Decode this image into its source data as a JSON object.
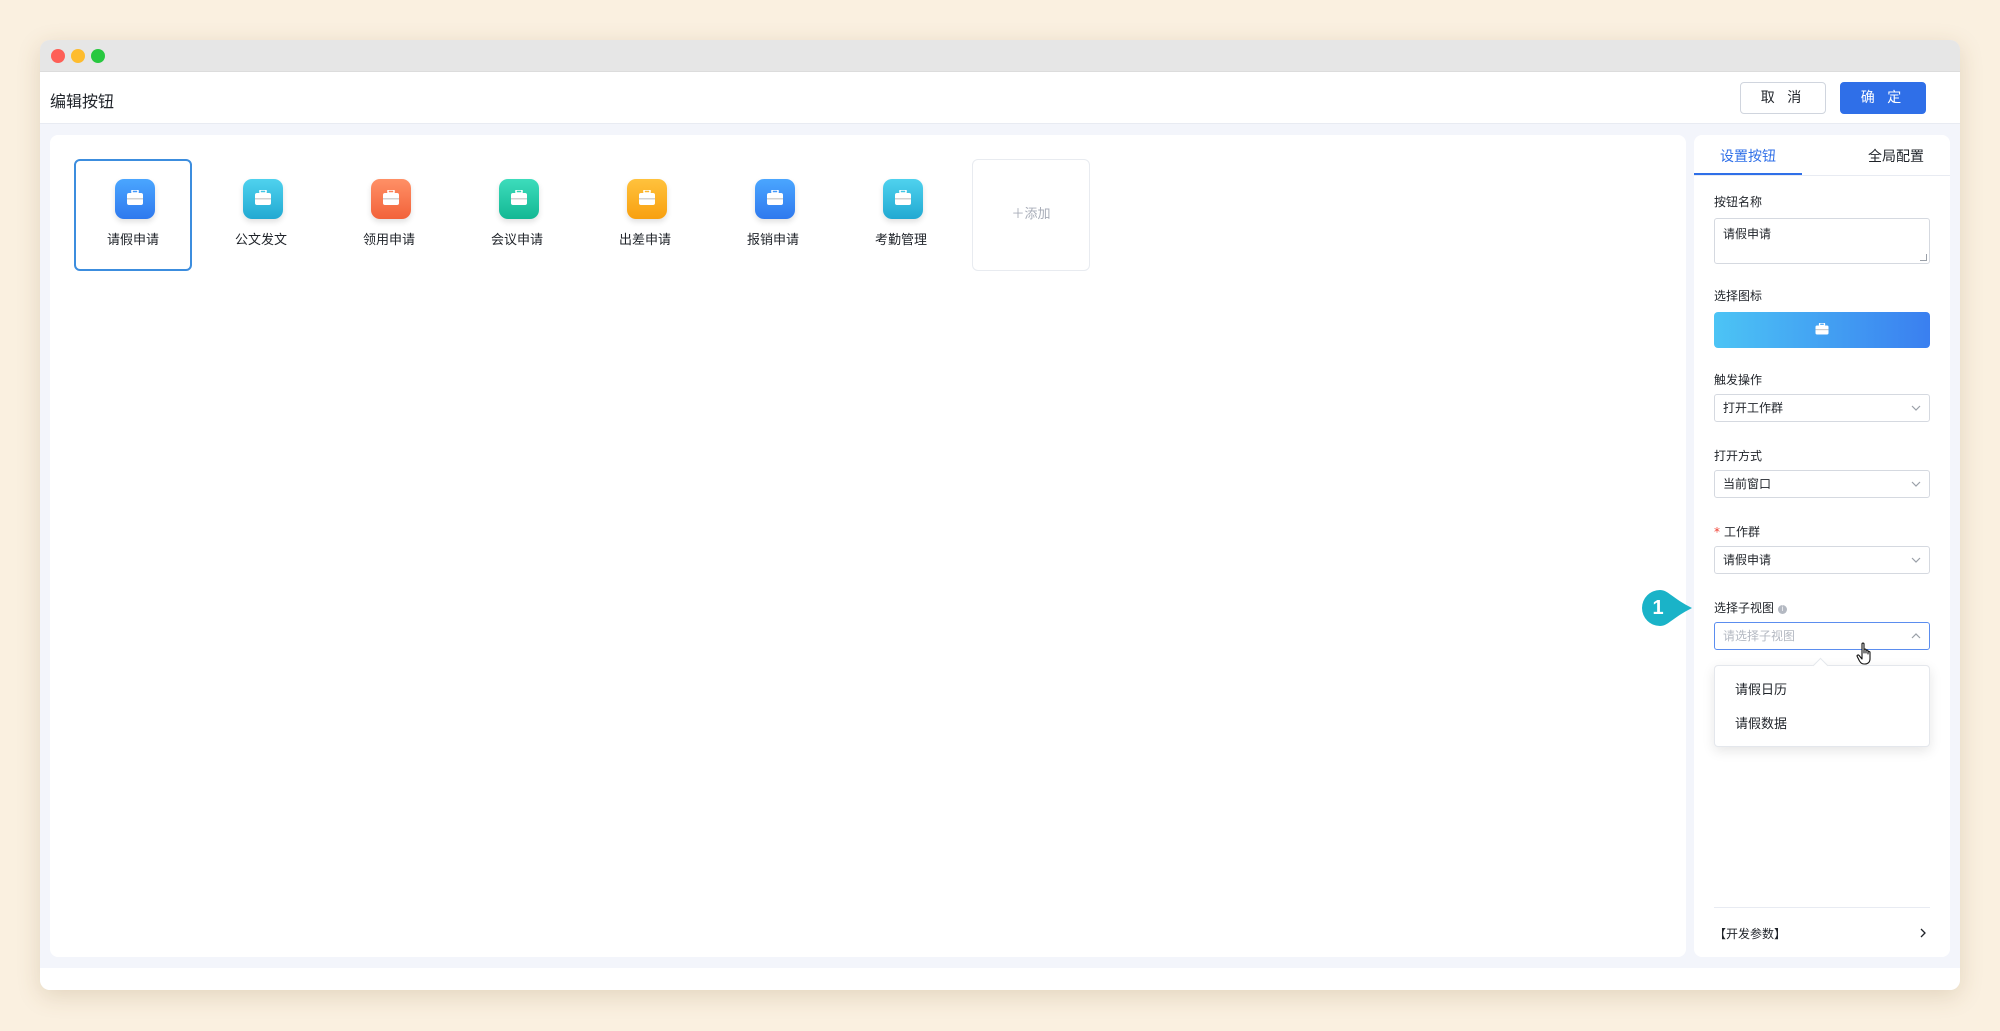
{
  "header": {
    "title": "编辑按钮",
    "cancel_label": "取 消",
    "confirm_label": "确 定"
  },
  "tiles": [
    {
      "label": "请假申请",
      "color": "#3a8ef6",
      "icon": "briefcase-icon"
    },
    {
      "label": "公文发文",
      "color": "#2ebcdc",
      "icon": "briefcase-icon"
    },
    {
      "label": "领用申请",
      "color": "#fa7a4a",
      "icon": "briefcase-icon"
    },
    {
      "label": "会议申请",
      "color": "#1ec6a6",
      "icon": "briefcase-icon"
    },
    {
      "label": "出差申请",
      "color": "#fdad1a",
      "icon": "briefcase-icon"
    },
    {
      "label": "报销申请",
      "color": "#3a8ef6",
      "icon": "briefcase-icon"
    },
    {
      "label": "考勤管理",
      "color": "#2ebcdc",
      "icon": "briefcase-icon"
    }
  ],
  "add_label": "＋添加",
  "panel": {
    "tabs": [
      "设置按钮",
      "全局配置"
    ],
    "button_name_label": "按钮名称",
    "button_name_value": "请假申请",
    "icon_label": "选择图标",
    "trigger_label": "触发操作",
    "trigger_value": "打开工作群",
    "open_mode_label": "打开方式",
    "open_mode_value": "当前窗口",
    "workgroup_label": "工作群",
    "workgroup_required": "*",
    "workgroup_value": "请假申请",
    "subview_label": "选择子视图",
    "subview_info": "i",
    "subview_placeholder": "请选择子视图",
    "subview_options": [
      "请假日历",
      "请假数据"
    ],
    "dev_params_label": "【开发参数】"
  },
  "callout_number": "1",
  "colors": {
    "accent": "#2f6fe8",
    "callout": "#1ab3c8"
  }
}
